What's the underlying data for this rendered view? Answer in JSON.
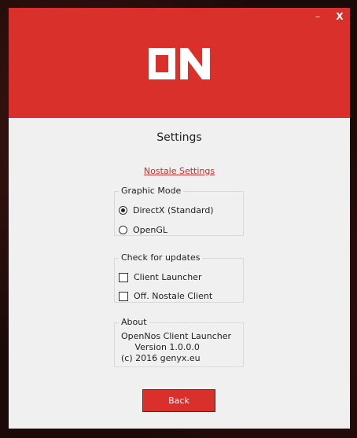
{
  "window": {
    "minimize_label": "–",
    "close_label": "X"
  },
  "header": {
    "logo_icon": "opennos-on-logo-icon",
    "color": "#d9302c"
  },
  "page": {
    "title": "Settings",
    "link_label": "Nostale Settings"
  },
  "graphic_mode": {
    "legend": "Graphic Mode",
    "options": [
      {
        "label": "DirectX (Standard)",
        "selected": true
      },
      {
        "label": "OpenGL",
        "selected": false
      }
    ]
  },
  "updates": {
    "legend": "Check for updates",
    "options": [
      {
        "label": "Client Launcher",
        "checked": false
      },
      {
        "label": "Off. Nostale Client",
        "checked": false
      }
    ]
  },
  "about": {
    "legend": "About",
    "lines": [
      "OpenNos Client Launcher",
      "     Version 1.0.0.0",
      "(c) 2016 genyx.eu"
    ]
  },
  "back_button": {
    "label": "Back"
  }
}
